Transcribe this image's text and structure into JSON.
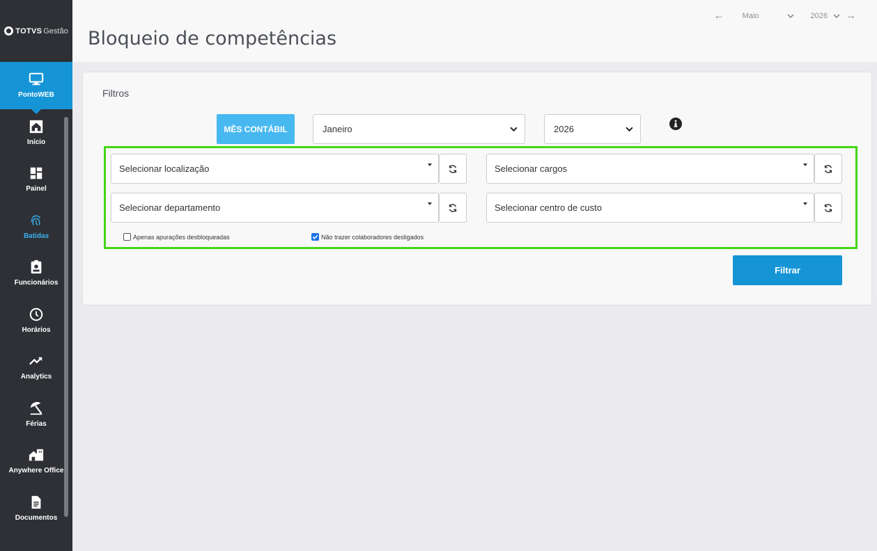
{
  "app": {
    "logo_brand": "TOTVS",
    "logo_suffix": "Gestão"
  },
  "sidebar": {
    "items": [
      {
        "label": "PontoWEB",
        "icon": "monitor-icon",
        "active": true
      },
      {
        "label": "Início",
        "icon": "home-icon"
      },
      {
        "label": "Painel",
        "icon": "dashboard-icon"
      },
      {
        "label": "Batidas",
        "icon": "fingerprint-icon",
        "highlight": true
      },
      {
        "label": "Funcionários",
        "icon": "badge-icon"
      },
      {
        "label": "Horários",
        "icon": "clock-icon"
      },
      {
        "label": "Analytics",
        "icon": "trend-icon"
      },
      {
        "label": "Férias",
        "icon": "umbrella-icon"
      },
      {
        "label": "Anywhere Office",
        "icon": "house-icon"
      },
      {
        "label": "Documentos",
        "icon": "document-icon"
      }
    ]
  },
  "header": {
    "title": "Bloqueio de competências",
    "period": {
      "month": "Maio",
      "year": "2026"
    }
  },
  "filters": {
    "title": "Filtros",
    "mes_button": "MÊS CONTÁBIL",
    "month_value": "Janeiro",
    "year_value": "2026",
    "localizacao": "Selecionar localização",
    "cargos": "Selecionar cargos",
    "departamento": "Selecionar departamento",
    "centro_custo": "Selecionar centro de custo",
    "chk_unlocked": {
      "label": "Apenas apurações desbloqueadas",
      "checked": false
    },
    "chk_dismissed": {
      "label": "Não trazer colaboradores desligados",
      "checked": true
    },
    "submit": "Filtrar"
  },
  "colors": {
    "sidebar_bg": "#2e3035",
    "active_blue": "#1595d6",
    "highlight_green": "#43d614",
    "light_blue": "#48b8f0"
  }
}
